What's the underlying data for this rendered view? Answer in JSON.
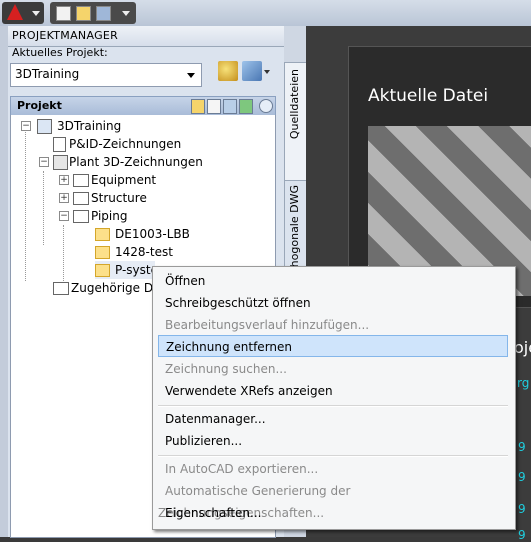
{
  "palette": {
    "title": "PROJEKTMANAGER",
    "current_project_label": "Aktuelles Projekt:",
    "current_project_value": "3DTraining",
    "project_section_title": "Projekt"
  },
  "tree": {
    "root": "3DTraining",
    "pid": "P&ID-Zeichnungen",
    "plant3d": "Plant 3D-Zeichnungen",
    "equipment": "Equipment",
    "structure": "Structure",
    "piping": "Piping",
    "file1": "DE1003-LBB",
    "file2": "1428-test",
    "file3": "P-syste",
    "related": "Zugehörige Da"
  },
  "side_tabs": {
    "source_files": "Quelldateien",
    "ortho_dwg": "Orthogonale DWG"
  },
  "right_panel": {
    "title": "Aktuelle Datei",
    "partial_1": "oje",
    "partial_2": "rg",
    "partial_3": "9",
    "partial_4": "9",
    "partial_5": "9",
    "partial_6": "9"
  },
  "context_menu": {
    "open": "Öffnen",
    "open_readonly": "Schreibgeschützt öffnen",
    "add_history": "Bearbeitungsverlauf hinzufügen...",
    "remove_drawing": "Zeichnung entfernen",
    "search_drawing": "Zeichnung suchen...",
    "show_xrefs": "Verwendete XRefs anzeigen",
    "data_manager": "Datenmanager...",
    "publish": "Publizieren...",
    "export_autocad": "In AutoCAD exportieren...",
    "auto_props": "Automatische Generierung der Zeichnungseigenschaften...",
    "properties": "Eigenschaften..."
  }
}
